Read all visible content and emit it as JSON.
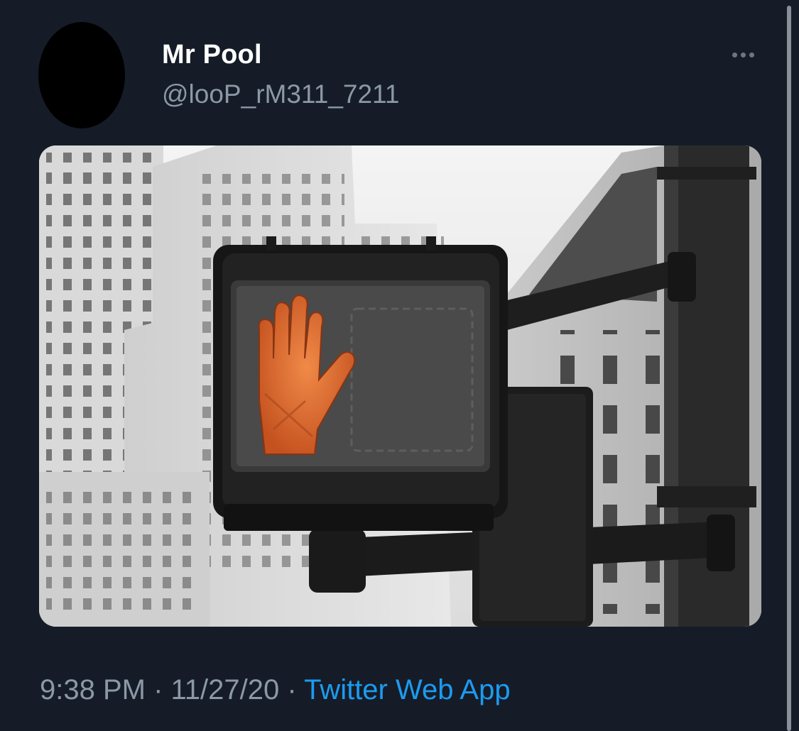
{
  "tweet": {
    "display_name": "Mr Pool",
    "handle": "@looP_rM311_7211",
    "time": "9:38 PM",
    "separator": " · ",
    "date": "11/27/20",
    "source": "Twitter Web App",
    "more_icon": "more-horizontal-icon",
    "media_subject": "crosswalk-dont-walk-signal-photo"
  },
  "colors": {
    "background": "#151c28",
    "name": "#ffffff",
    "secondary": "#8b98a5",
    "link": "#1d9bf0",
    "signal_hand": "#e26a2c"
  }
}
